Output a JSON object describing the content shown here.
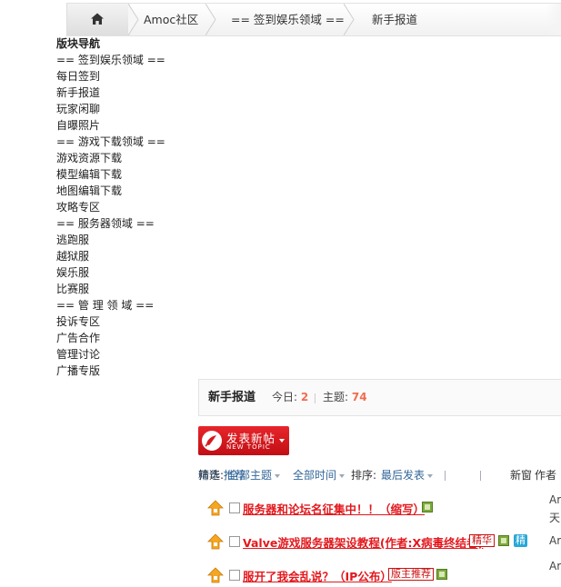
{
  "breadcrumb": {
    "home_icon": "home-icon",
    "items": [
      "Amoc社区",
      "== 签到娱乐领域 ==",
      "新手报道"
    ]
  },
  "sidenav": {
    "title": "版块导航",
    "items": [
      "== 签到娱乐领域 ==",
      "每日签到",
      "新手报道",
      "玩家闲聊",
      "自曝照片",
      "== 游戏下载领域 ==",
      "游戏资源下载",
      "模型编辑下载",
      "地图编辑下载",
      "攻略专区",
      "== 服务器领域 ==",
      "逃跑服",
      "越狱服",
      "娱乐服",
      "比赛服",
      "== 管 理 领 域 ==",
      "投诉专区",
      "广告合作",
      "管理讨论",
      "广播专版"
    ]
  },
  "forum": {
    "name": "新手报道",
    "today_label": "今日:",
    "today_value": "2",
    "topics_label": "主题:",
    "topics_value": "74"
  },
  "new_topic": {
    "label": "发表新帖",
    "sublabel": "NEW TOPIC"
  },
  "filter": {
    "label": "筛选:",
    "all_topics": "全部主题",
    "all_time": "全部时间",
    "sort_label": "排序:",
    "sort_value": "最后发表",
    "digest": "精华",
    "recommend": "推荐",
    "new_window": "新窗",
    "author": "作者"
  },
  "threads": [
    {
      "title": "服务器和论坛名征集中！！（缩写）",
      "tags": [],
      "has_image": true,
      "digest": false,
      "author": "Ar",
      "author2": "天"
    },
    {
      "title": "Valve游戏服务器架设教程(作者:X病毒终结者)",
      "tags": [
        "精华"
      ],
      "has_image": true,
      "digest": true,
      "digest_label": "精",
      "author": "Ar"
    },
    {
      "title": "服开了我会乱说？（IP公布）",
      "tags": [
        "版主推荐"
      ],
      "has_image": true,
      "digest": false,
      "author": "Ar"
    }
  ],
  "colors": {
    "accent_red": "#e3181d",
    "link_blue": "#336699",
    "stat_orange": "#f26c4f",
    "button_red": "#d41a1f"
  }
}
